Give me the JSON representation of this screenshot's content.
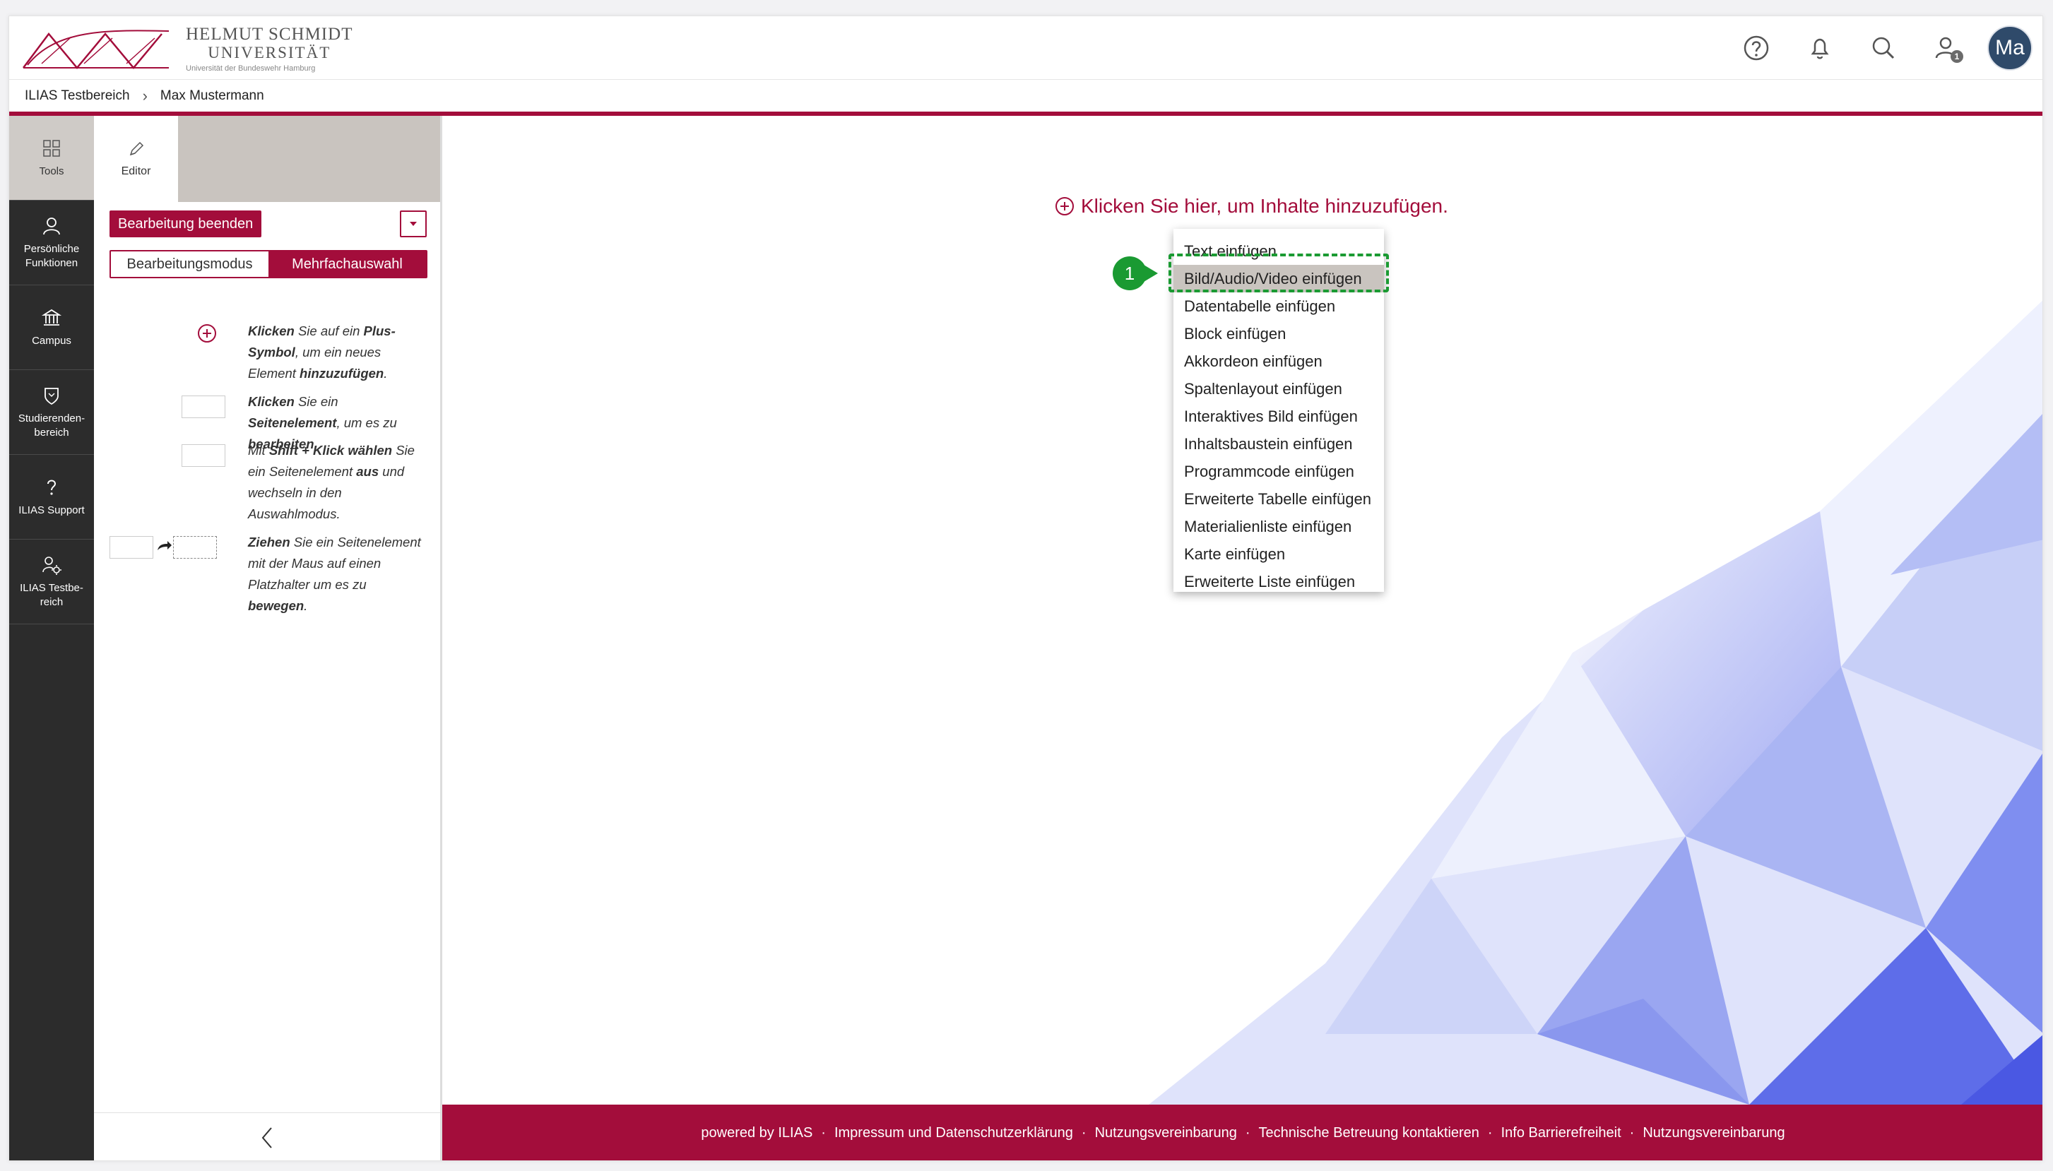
{
  "header": {
    "logo": {
      "line1": "HELMUT SCHMIDT",
      "line2": "UNIVERSITÄT",
      "line3": "Universität der Bundeswehr Hamburg"
    },
    "icons": [
      "help-icon",
      "bell-icon",
      "search-icon",
      "user-icon"
    ],
    "badge_count": "1",
    "avatar_initials": "Ma"
  },
  "breadcrumb": {
    "items": [
      "ILIAS Testbereich",
      "Max Mustermann"
    ]
  },
  "sidebar": {
    "items": [
      {
        "label": "Tools",
        "icon": "grid-icon"
      },
      {
        "label": "Persönliche Funktionen",
        "icon": "person-icon"
      },
      {
        "label": "Campus",
        "icon": "building-icon"
      },
      {
        "label": "Studierenden-bereich",
        "icon": "shield-icon"
      },
      {
        "label": "ILIAS Support",
        "icon": "question-icon"
      },
      {
        "label": "ILIAS Testbe-reich",
        "icon": "users-gear-icon"
      }
    ]
  },
  "toolpanel": {
    "tab_label": "Editor",
    "finish_button": "Bearbeitung beenden",
    "modes": [
      "Bearbeitungsmodus",
      "Mehrfachauswahl"
    ],
    "help": {
      "h1": [
        "Klicken",
        " Sie auf ein ",
        "Plus-Symbol",
        ", um ein neues Element ",
        "hinzuzufügen",
        "."
      ],
      "h2": [
        "Klicken",
        " Sie ein ",
        "Seitenelement",
        ", um es zu ",
        "bearbeiten",
        "."
      ],
      "h3": [
        "Mit ",
        "Shift + Klick wählen",
        " Sie ein Seitenelement ",
        "aus",
        " und wechseln in den Auswahlmodus."
      ],
      "h4": [
        "Ziehen",
        " Sie ein Seitenelement mit der Maus auf einen Platzhalter um es zu ",
        "bewegen",
        "."
      ]
    }
  },
  "content": {
    "add_hint": "Klicken Sie hier, um Inhalte hinzuzufügen.",
    "menu_items": [
      "Text einfügen",
      "Bild/Audio/Video einfügen",
      "Datentabelle einfügen",
      "Block einfügen",
      "Akkordeon einfügen",
      "Spaltenlayout einfügen",
      "Interaktives Bild einfügen",
      "Inhaltsbaustein einfügen",
      "Programmcode einfügen",
      "Erweiterte Tabelle einfügen",
      "Materialienliste einfügen",
      "Karte einfügen",
      "Erweiterte Liste einfügen"
    ],
    "highlighted_index": 1,
    "marker_label": "1"
  },
  "footer": {
    "links": [
      "powered by ILIAS",
      "Impressum und Datenschutzerklärung",
      "Nutzungsvereinbarung",
      "Technische Betreuung kontaktieren",
      "Info Barrierefreiheit",
      "Nutzungsvereinbarung"
    ]
  },
  "colors": {
    "brand": "#a30d3b",
    "sidebar": "#2c2c2c",
    "highlight": "#1a9a32",
    "tab_bg": "#c9c4bf"
  }
}
